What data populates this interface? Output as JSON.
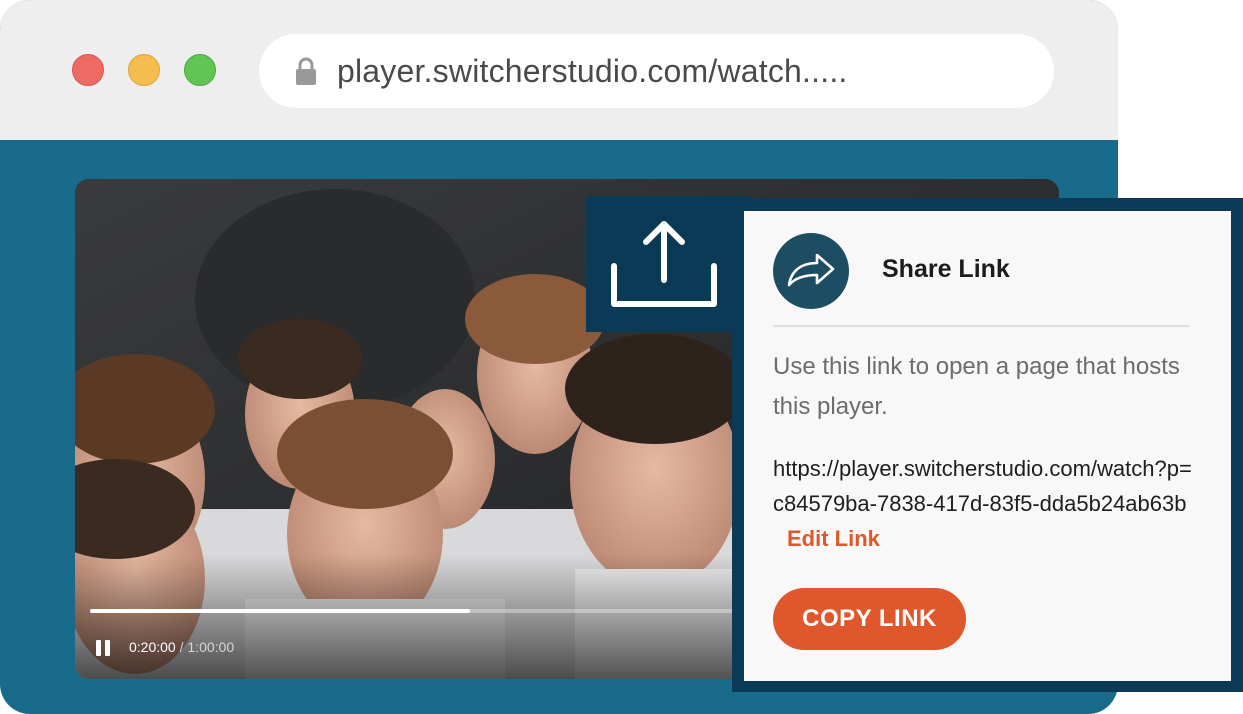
{
  "browser": {
    "url": "player.switcherstudio.com/watch.....",
    "colors": {
      "chrome": "#eeeeee",
      "page": "#196b8b",
      "close": "#ee6b63",
      "minimize": "#f5bd4f",
      "maximize": "#61c553"
    }
  },
  "player": {
    "current_time": "0:20:00",
    "separator": " / ",
    "duration": "1:00:00",
    "progress_fraction": 0.4,
    "state": "playing"
  },
  "share_panel": {
    "title": "Share Link",
    "description": "Use this link to open a page that hosts this player.",
    "link": "https://player.switcherstudio.com/watch?p=c84579ba-7838-417d-83f5-dda5b24ab63b",
    "edit_label": "Edit Link",
    "copy_label": "COPY LINK",
    "colors": {
      "accent": "#e0572c",
      "frame": "#0b3a56",
      "icon_bg": "#1d4d63"
    }
  },
  "icons": [
    "lock-icon",
    "upload-share-icon",
    "share-arrow-icon",
    "pause-icon"
  ]
}
